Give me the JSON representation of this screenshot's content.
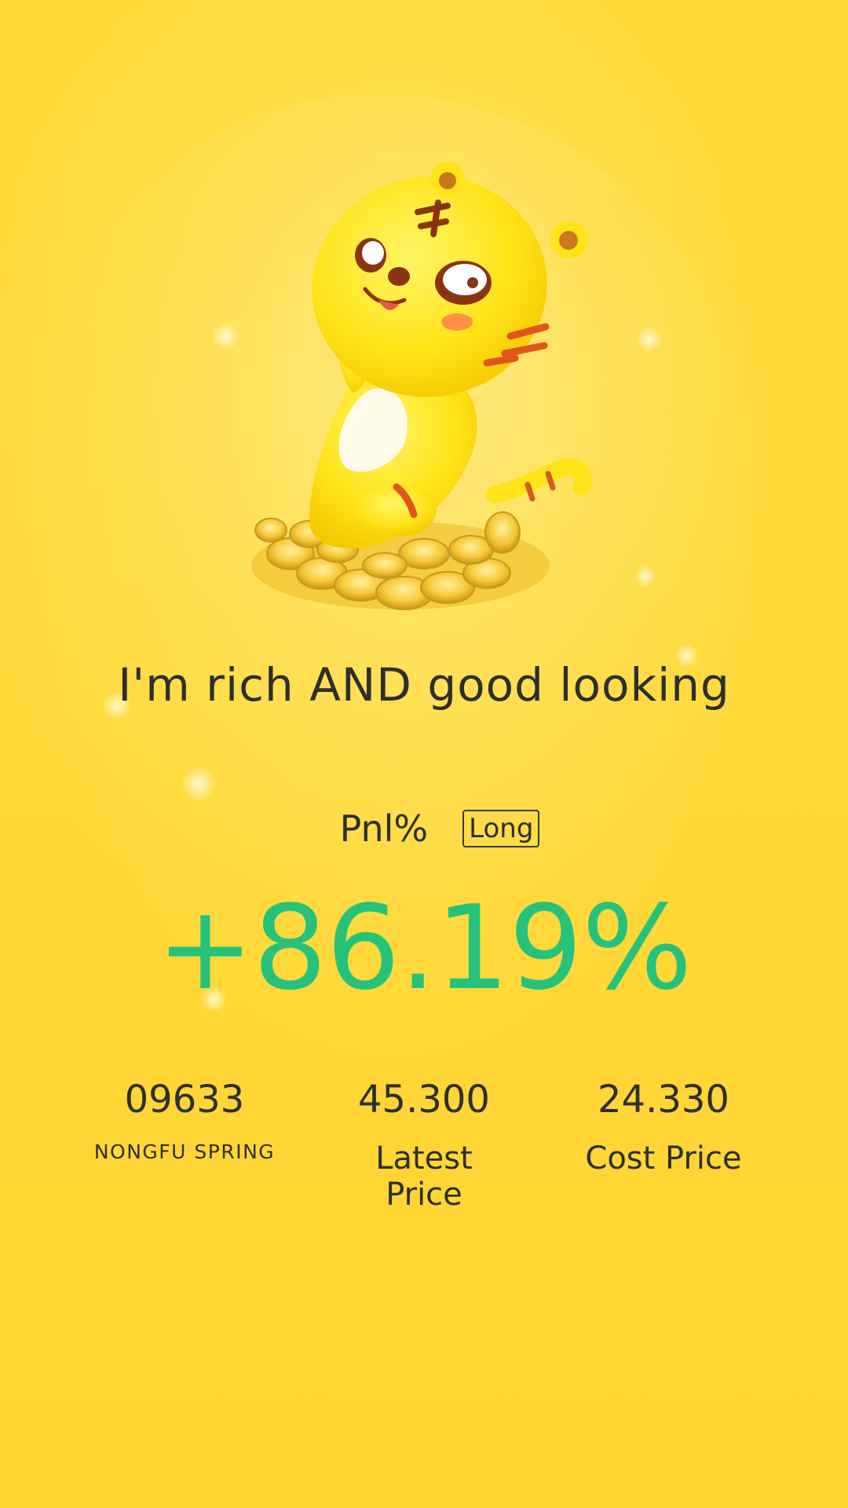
{
  "headline": "I'm rich AND good looking",
  "pnl": {
    "label": "Pnl%",
    "direction": "Long",
    "value": "+86.19%"
  },
  "stats": [
    {
      "value": "09633",
      "label": "NONGFU SPRING"
    },
    {
      "value": "45.300",
      "label": "Latest Price"
    },
    {
      "value": "24.330",
      "label": "Cost Price"
    }
  ],
  "colors": {
    "background": "#ffd93a",
    "positive": "#26c27c",
    "text": "#2e2e2e"
  },
  "icons": {
    "mascot": "tiger-mascot-on-coins"
  }
}
